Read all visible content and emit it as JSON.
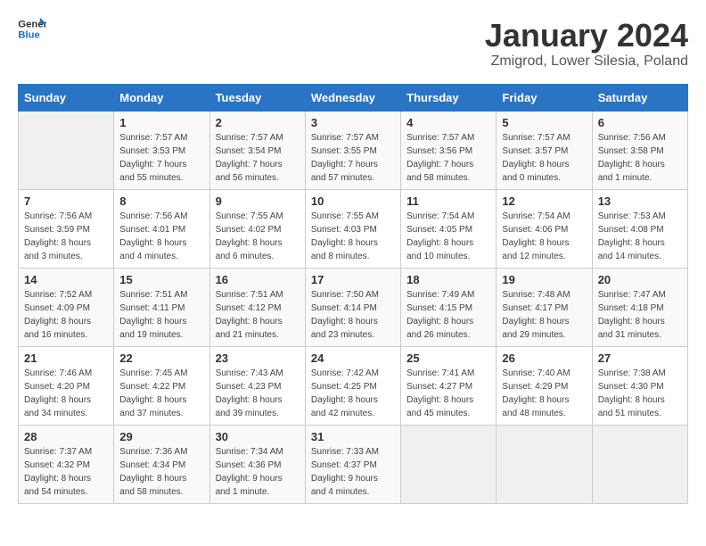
{
  "logo": {
    "line1": "General",
    "line2": "Blue"
  },
  "calendar": {
    "title": "January 2024",
    "subtitle": "Zmigrod, Lower Silesia, Poland"
  },
  "headers": [
    "Sunday",
    "Monday",
    "Tuesday",
    "Wednesday",
    "Thursday",
    "Friday",
    "Saturday"
  ],
  "weeks": [
    [
      {
        "day": "",
        "detail": ""
      },
      {
        "day": "1",
        "detail": "Sunrise: 7:57 AM\nSunset: 3:53 PM\nDaylight: 7 hours\nand 55 minutes."
      },
      {
        "day": "2",
        "detail": "Sunrise: 7:57 AM\nSunset: 3:54 PM\nDaylight: 7 hours\nand 56 minutes."
      },
      {
        "day": "3",
        "detail": "Sunrise: 7:57 AM\nSunset: 3:55 PM\nDaylight: 7 hours\nand 57 minutes."
      },
      {
        "day": "4",
        "detail": "Sunrise: 7:57 AM\nSunset: 3:56 PM\nDaylight: 7 hours\nand 58 minutes."
      },
      {
        "day": "5",
        "detail": "Sunrise: 7:57 AM\nSunset: 3:57 PM\nDaylight: 8 hours\nand 0 minutes."
      },
      {
        "day": "6",
        "detail": "Sunrise: 7:56 AM\nSunset: 3:58 PM\nDaylight: 8 hours\nand 1 minute."
      }
    ],
    [
      {
        "day": "7",
        "detail": "Sunrise: 7:56 AM\nSunset: 3:59 PM\nDaylight: 8 hours\nand 3 minutes."
      },
      {
        "day": "8",
        "detail": "Sunrise: 7:56 AM\nSunset: 4:01 PM\nDaylight: 8 hours\nand 4 minutes."
      },
      {
        "day": "9",
        "detail": "Sunrise: 7:55 AM\nSunset: 4:02 PM\nDaylight: 8 hours\nand 6 minutes."
      },
      {
        "day": "10",
        "detail": "Sunrise: 7:55 AM\nSunset: 4:03 PM\nDaylight: 8 hours\nand 8 minutes."
      },
      {
        "day": "11",
        "detail": "Sunrise: 7:54 AM\nSunset: 4:05 PM\nDaylight: 8 hours\nand 10 minutes."
      },
      {
        "day": "12",
        "detail": "Sunrise: 7:54 AM\nSunset: 4:06 PM\nDaylight: 8 hours\nand 12 minutes."
      },
      {
        "day": "13",
        "detail": "Sunrise: 7:53 AM\nSunset: 4:08 PM\nDaylight: 8 hours\nand 14 minutes."
      }
    ],
    [
      {
        "day": "14",
        "detail": "Sunrise: 7:52 AM\nSunset: 4:09 PM\nDaylight: 8 hours\nand 16 minutes."
      },
      {
        "day": "15",
        "detail": "Sunrise: 7:51 AM\nSunset: 4:11 PM\nDaylight: 8 hours\nand 19 minutes."
      },
      {
        "day": "16",
        "detail": "Sunrise: 7:51 AM\nSunset: 4:12 PM\nDaylight: 8 hours\nand 21 minutes."
      },
      {
        "day": "17",
        "detail": "Sunrise: 7:50 AM\nSunset: 4:14 PM\nDaylight: 8 hours\nand 23 minutes."
      },
      {
        "day": "18",
        "detail": "Sunrise: 7:49 AM\nSunset: 4:15 PM\nDaylight: 8 hours\nand 26 minutes."
      },
      {
        "day": "19",
        "detail": "Sunrise: 7:48 AM\nSunset: 4:17 PM\nDaylight: 8 hours\nand 29 minutes."
      },
      {
        "day": "20",
        "detail": "Sunrise: 7:47 AM\nSunset: 4:18 PM\nDaylight: 8 hours\nand 31 minutes."
      }
    ],
    [
      {
        "day": "21",
        "detail": "Sunrise: 7:46 AM\nSunset: 4:20 PM\nDaylight: 8 hours\nand 34 minutes."
      },
      {
        "day": "22",
        "detail": "Sunrise: 7:45 AM\nSunset: 4:22 PM\nDaylight: 8 hours\nand 37 minutes."
      },
      {
        "day": "23",
        "detail": "Sunrise: 7:43 AM\nSunset: 4:23 PM\nDaylight: 8 hours\nand 39 minutes."
      },
      {
        "day": "24",
        "detail": "Sunrise: 7:42 AM\nSunset: 4:25 PM\nDaylight: 8 hours\nand 42 minutes."
      },
      {
        "day": "25",
        "detail": "Sunrise: 7:41 AM\nSunset: 4:27 PM\nDaylight: 8 hours\nand 45 minutes."
      },
      {
        "day": "26",
        "detail": "Sunrise: 7:40 AM\nSunset: 4:29 PM\nDaylight: 8 hours\nand 48 minutes."
      },
      {
        "day": "27",
        "detail": "Sunrise: 7:38 AM\nSunset: 4:30 PM\nDaylight: 8 hours\nand 51 minutes."
      }
    ],
    [
      {
        "day": "28",
        "detail": "Sunrise: 7:37 AM\nSunset: 4:32 PM\nDaylight: 8 hours\nand 54 minutes."
      },
      {
        "day": "29",
        "detail": "Sunrise: 7:36 AM\nSunset: 4:34 PM\nDaylight: 8 hours\nand 58 minutes."
      },
      {
        "day": "30",
        "detail": "Sunrise: 7:34 AM\nSunset: 4:36 PM\nDaylight: 9 hours\nand 1 minute."
      },
      {
        "day": "31",
        "detail": "Sunrise: 7:33 AM\nSunset: 4:37 PM\nDaylight: 9 hours\nand 4 minutes."
      },
      {
        "day": "",
        "detail": ""
      },
      {
        "day": "",
        "detail": ""
      },
      {
        "day": "",
        "detail": ""
      }
    ]
  ]
}
